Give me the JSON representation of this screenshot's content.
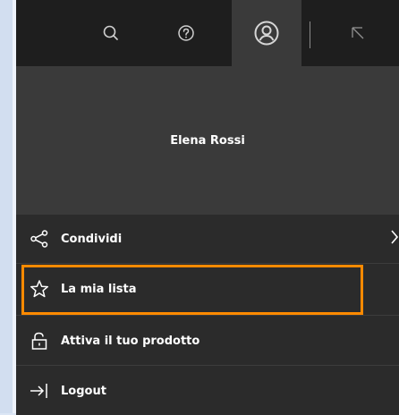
{
  "topbar": {
    "icons": [
      "search-icon",
      "help-icon",
      "user-icon",
      "collapse-icon"
    ]
  },
  "profile": {
    "name": "Elena Rossi"
  },
  "menu": {
    "items": [
      {
        "label": "Condividi",
        "icon": "share-icon",
        "has_submenu": true
      },
      {
        "label": "La mia lista",
        "icon": "star-icon"
      },
      {
        "label": "Attiva il tuo prodotto",
        "icon": "lock-icon"
      },
      {
        "label": "Logout",
        "icon": "logout-icon"
      }
    ]
  },
  "colors": {
    "panel_bg": "#2b2b2b",
    "topbar_bg": "#1e1e1e",
    "active_bg": "#3a3a3a",
    "highlight": "#ff8a00",
    "text": "#ffffff"
  }
}
